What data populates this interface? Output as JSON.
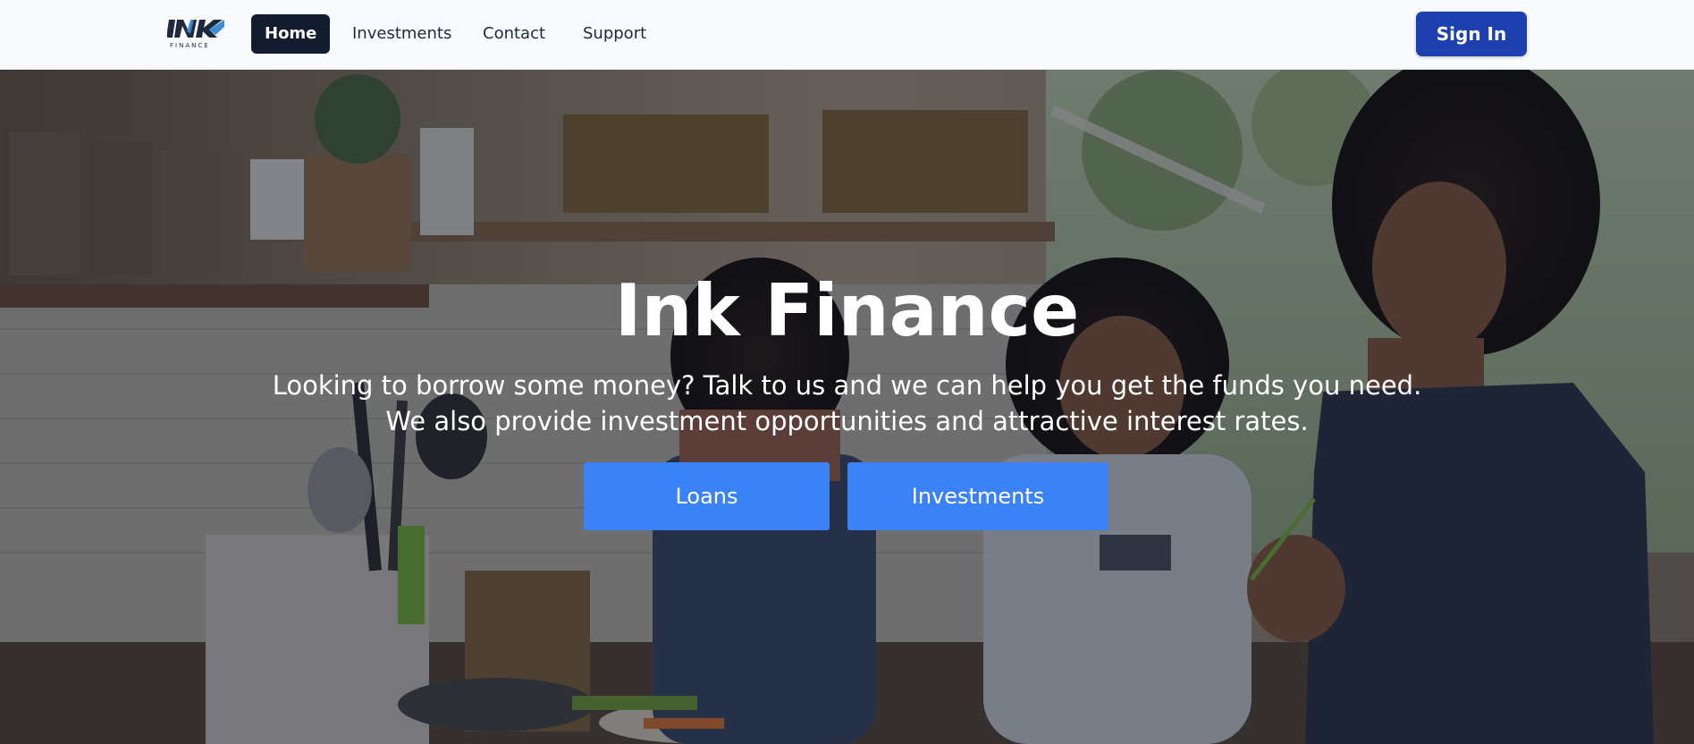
{
  "brand": {
    "logo_mark": "INK",
    "logo_sub": "FINANCE",
    "colors": {
      "logo_dark": "#1e293b",
      "logo_accent": "#3b8fd6"
    }
  },
  "nav": {
    "items": [
      {
        "label": "Home",
        "active": true
      },
      {
        "label": "Investments",
        "active": false
      },
      {
        "label": "Contact",
        "active": false
      },
      {
        "label": "Support",
        "active": false
      }
    ],
    "signin_label": "Sign In"
  },
  "hero": {
    "title": "Ink Finance",
    "subtitle_line1": "Looking to borrow some money? Talk to us and we can help you get the funds you need.",
    "subtitle_line2": "We also provide investment opportunities and attractive interest rates.",
    "buttons": {
      "loans": "Loans",
      "investments": "Investments"
    },
    "image_subject": "family-in-kitchen-photo"
  },
  "theme": {
    "nav_bg": "#f8fafc",
    "active_nav_bg": "#131b2e",
    "signin_bg": "#1e40af",
    "cta_bg": "#3b82f6"
  }
}
